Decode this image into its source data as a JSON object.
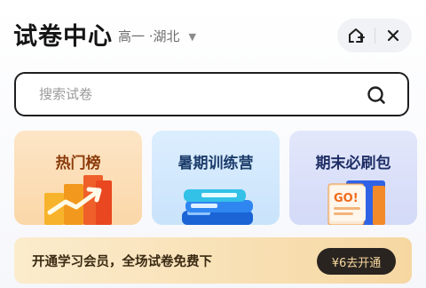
{
  "header": {
    "title": "试卷中心",
    "grade_region": "高一 ·湖北",
    "caret_icon": "caret-down-icon",
    "share_icon": "add-to-home-icon",
    "close_icon": "close-icon"
  },
  "search": {
    "placeholder": "搜索试卷",
    "icon": "search-icon"
  },
  "cards": [
    {
      "label": "热门榜",
      "icon": "trending-chart-icon"
    },
    {
      "label": "暑期训练营",
      "icon": "book-stack-icon"
    },
    {
      "label": "期末必刷包",
      "icon": "go-book-icon"
    }
  ],
  "banner": {
    "text": "开通学习会员，全场试卷免费下",
    "button_label": "¥6去开通"
  },
  "colors": {
    "hot_card_bg": "#fbd7a8",
    "summer_card_bg": "#c9e3fb",
    "final_card_bg": "#d3daf7",
    "banner_button_bg": "#2a2420",
    "banner_button_text": "#f8d9a0"
  }
}
